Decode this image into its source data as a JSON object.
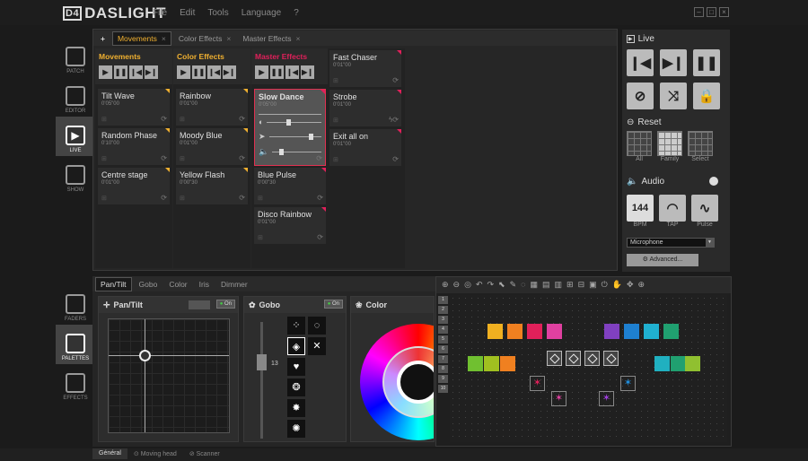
{
  "app": {
    "title": "DASLIGHT",
    "logo_mark": "D4"
  },
  "menu": [
    "File",
    "Edit",
    "Tools",
    "Language",
    "?"
  ],
  "leftnav": [
    {
      "label": "PATCH",
      "icon": "patch-icon"
    },
    {
      "label": "EDITOR",
      "icon": "editor-icon"
    },
    {
      "label": "LIVE",
      "icon": "play-icon"
    },
    {
      "label": "SHOW",
      "icon": "show-icon"
    }
  ],
  "leftnav2": [
    {
      "label": "FADERS",
      "icon": "faders-icon"
    },
    {
      "label": "PALETTES",
      "icon": "palettes-icon"
    },
    {
      "label": "EFFECTS",
      "icon": "effects-icon"
    }
  ],
  "scene_tabs": [
    "Movements",
    "Color Effects",
    "Master Effects"
  ],
  "columns": [
    {
      "title": "Movements",
      "color": "#f0b030",
      "cells": [
        {
          "n": "Tilt Wave",
          "t": "0'05\"00"
        },
        {
          "n": "Random Phase",
          "t": "0'10\"00"
        },
        {
          "n": "Centre stage",
          "t": "0'01\"00"
        }
      ]
    },
    {
      "title": "Color Effects",
      "color": "#f0b030",
      "cells": [
        {
          "n": "Rainbow",
          "t": "0'01\"00"
        },
        {
          "n": "Moody Blue",
          "t": "0'01\"00"
        },
        {
          "n": "Yellow Flash",
          "t": "0'00\"30"
        }
      ]
    },
    {
      "title": "Master Effects",
      "color": "#e0205a",
      "cells": [
        {
          "n": "Slow Dance",
          "t": "0'05\"00"
        },
        {
          "n": "Blue Pulse",
          "t": "0'00\"30"
        },
        {
          "n": "Disco Rainbow",
          "t": "0'01\"00"
        }
      ]
    },
    {
      "title": "",
      "color": "#e0205a",
      "cells": [
        {
          "n": "Fast Chaser",
          "t": "0'01\"00"
        },
        {
          "n": "Strobe",
          "t": "0'01\"00"
        },
        {
          "n": "Exit all on",
          "t": "0'01\"00"
        }
      ]
    }
  ],
  "live": {
    "title": "Live",
    "reset": "Reset",
    "reset_labels": [
      "All",
      "Family",
      "Select"
    ],
    "audio": "Audio",
    "bpm": "144",
    "audio_labels": [
      "BPM",
      "TAP",
      "Pulse"
    ],
    "input": "Microphone",
    "advanced": "Advanced..."
  },
  "palette_tabs": [
    "Pan/Tilt",
    "Gobo",
    "Color",
    "Iris",
    "Dimmer"
  ],
  "pantilt": {
    "title": "Pan/Tilt",
    "on": "On"
  },
  "gobo": {
    "title": "Gobo",
    "on": "On",
    "value": "13"
  },
  "color": {
    "title": "Color"
  },
  "rows": [
    "1",
    "2",
    "3",
    "4",
    "5",
    "6",
    "7",
    "8",
    "9",
    "10"
  ],
  "bottom_tabs": [
    "Général",
    "Moving head",
    "Scanner"
  ],
  "colors": {
    "accent": "#f0b030",
    "master": "#e0205a"
  }
}
